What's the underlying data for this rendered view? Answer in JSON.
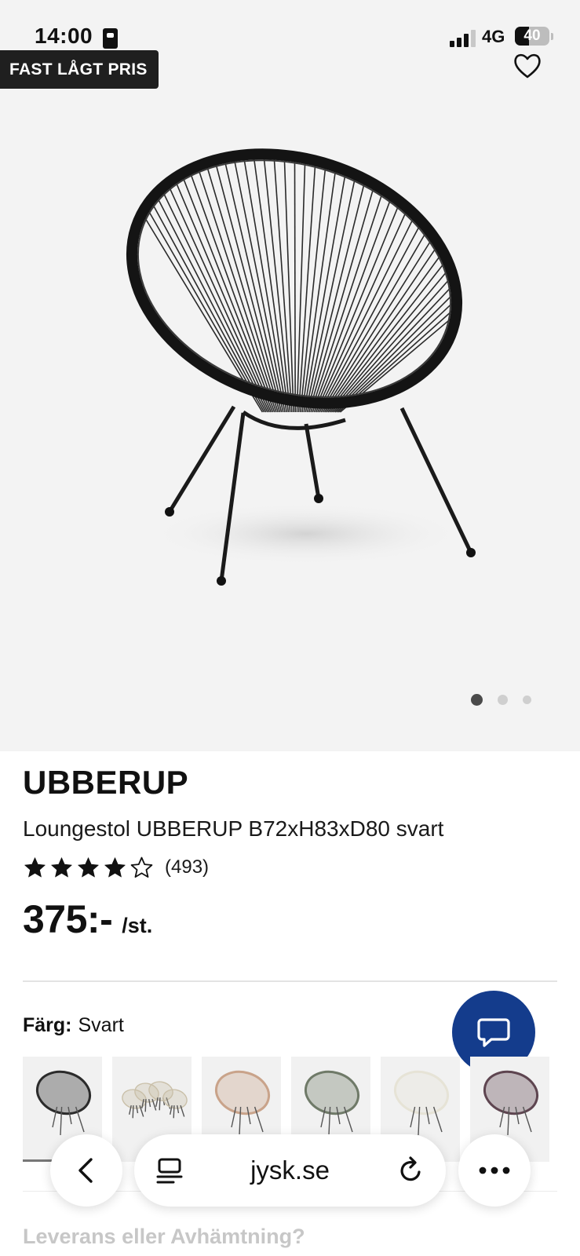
{
  "status_bar": {
    "time": "14:00",
    "network": "4G",
    "battery": "40",
    "battery_level": 0.4
  },
  "hero": {
    "badge": "FAST LÅGT PRIS",
    "image_dots": {
      "count": 3,
      "active": 0
    }
  },
  "product": {
    "brand": "UBBERUP",
    "description": "Loungestol UBBERUP B72xH83xD80 svart",
    "rating": 4,
    "rating_max": 5,
    "reviews": "(493)",
    "price": "375:-",
    "unit": "/st."
  },
  "color": {
    "label": "Färg:",
    "value": "Svart",
    "swatches": [
      "black",
      "beige-set",
      "rose",
      "green",
      "white",
      "purple"
    ]
  },
  "browser": {
    "url": "jysk.se"
  },
  "next_section": {
    "title": "Leverans eller Avhämtning?"
  },
  "colors": {
    "chat_button": "#143c8c",
    "badge_bg": "#1f1f1f",
    "hero_bg": "#f3f3f3"
  },
  "icons": {
    "favorite": "heart-outline-icon",
    "chat": "chat-bubble-icon",
    "back": "chevron-left-icon",
    "reader": "reader-icon",
    "reload": "reload-icon",
    "more": "ellipsis-icon"
  }
}
